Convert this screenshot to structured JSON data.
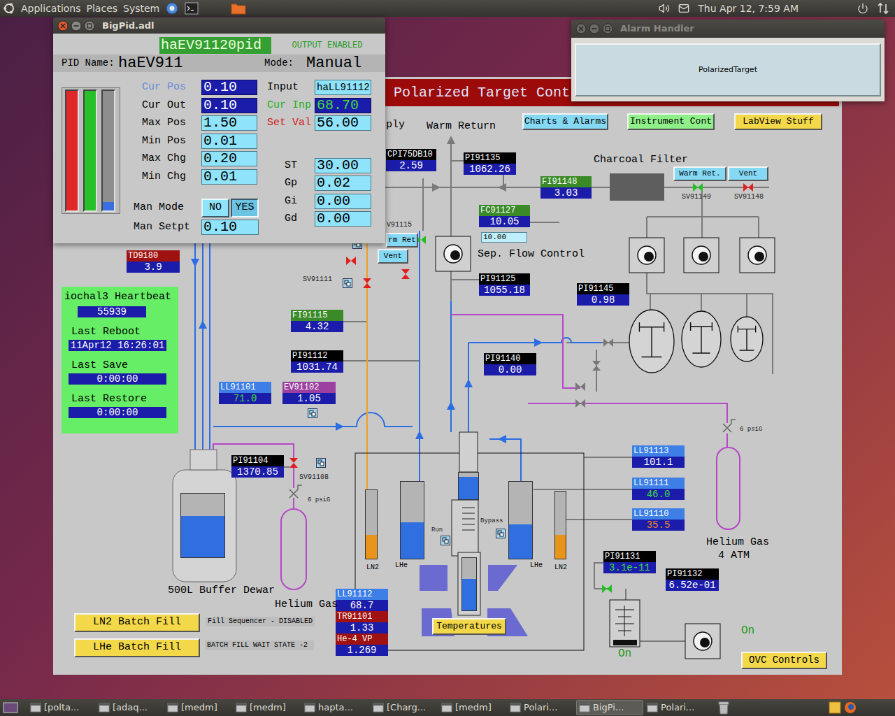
{
  "top_panel": {
    "menus": [
      "Applications",
      "Places",
      "System"
    ],
    "clock": "Thu Apr 12, 7:59 AM"
  },
  "taskbar": [
    {
      "label": "[polta...",
      "selected": false
    },
    {
      "label": "[adaq...",
      "selected": false
    },
    {
      "label": "[medm]",
      "selected": false
    },
    {
      "label": "[medm]",
      "selected": false
    },
    {
      "label": "hapta...",
      "selected": false
    },
    {
      "label": "[Charg...",
      "selected": false
    },
    {
      "label": "[medm]",
      "selected": false
    },
    {
      "label": "Polari...",
      "selected": false
    },
    {
      "label": "BigPi...",
      "selected": true
    },
    {
      "label": "Polari...",
      "selected": false
    }
  ],
  "bigpid_window": {
    "title": "BigPid.adl",
    "active": true,
    "pid_tag": "haEV91120pid",
    "output_status": "OUTPUT ENABLED",
    "pid_name_label": "PID Name:",
    "pid_name": "haEV911",
    "mode_label": "Mode:",
    "mode": "Manual",
    "meters": [
      {
        "level": 1,
        "color": "#e02828"
      },
      {
        "level": 1,
        "color": "#28c028"
      },
      {
        "level": 0.07,
        "color": "#3a6fe0"
      }
    ],
    "position_fields": [
      {
        "label": "Cur Pos",
        "value": "0.10",
        "kind": "readback",
        "label_color": "#6a8ad8",
        "value_color": "#ffffff"
      },
      {
        "label": "Cur Out",
        "value": "0.10",
        "kind": "readback",
        "label_color": "#000000",
        "value_color": "#ffffff"
      },
      {
        "label": "Max Pos",
        "value": "1.50",
        "kind": "entry",
        "label_color": "#000000"
      },
      {
        "label": "Min Pos",
        "value": "0.01",
        "kind": "entry",
        "label_color": "#000000"
      },
      {
        "label": "Max Chg",
        "value": "0.20",
        "kind": "entry",
        "label_color": "#000000"
      },
      {
        "label": "Min Chg",
        "value": "0.01",
        "kind": "entry",
        "label_color": "#000000"
      }
    ],
    "input_fields": [
      {
        "label": "Input",
        "value": "haLL91112",
        "kind": "entry",
        "label_color": "#000000"
      },
      {
        "label": "Cur Inp",
        "value": "68.70",
        "kind": "readback",
        "label_color": "#20b020",
        "value_color": "#3ddc3d"
      },
      {
        "label": "Set Val",
        "value": "56.00",
        "kind": "entry",
        "label_color": "#d02020"
      }
    ],
    "gain_fields": [
      {
        "label": "ST",
        "value": "30.00",
        "kind": "entry",
        "label_color": "#000000"
      },
      {
        "label": "Gp",
        "value": "0.02",
        "kind": "entry",
        "label_color": "#000000"
      },
      {
        "label": "Gi",
        "value": "0.00",
        "kind": "entry",
        "label_color": "#000000"
      },
      {
        "label": "Gd",
        "value": "0.00",
        "kind": "entry",
        "label_color": "#000000"
      }
    ],
    "man_mode": {
      "label": "Man Mode",
      "options": [
        {
          "label": "NO",
          "selected": false
        },
        {
          "label": "YES",
          "selected": true
        }
      ]
    },
    "man_setpt": {
      "label": "Man Setpt",
      "value": "0.10"
    }
  },
  "alarm_handler_window": {
    "title": "Alarm Handler",
    "active": false,
    "group": "PolarizedTarget"
  },
  "main_window": {
    "header": "Polarized Target Cont",
    "buttons": [
      {
        "label": "Charts & Alarms",
        "color": "#86d9f5"
      },
      {
        "label": "Instrument Cont",
        "color": "#8ff08a"
      },
      {
        "label": "LabView Stuff",
        "color": "#f3d84a"
      },
      {
        "label": "Warm Ret.",
        "color": "#86d9f5"
      },
      {
        "label": "Vent",
        "color": "#86d9f5"
      },
      {
        "label": "rm Ret",
        "color": "#86d9f5"
      },
      {
        "label": "Vent",
        "color": "#86d9f5"
      },
      {
        "label": "LN2 Batch Fill",
        "color": "#f3d84a"
      },
      {
        "label": "LHe Batch Fill",
        "color": "#f3d84a"
      },
      {
        "label": "Temperatures",
        "color": "#f3d84a"
      },
      {
        "label": "OVC Controls",
        "color": "#f3d84a"
      }
    ],
    "readouts": [
      {
        "tag": "CPI75DB10",
        "value": "2.59",
        "color": "#000000",
        "value_color": "#ffffff"
      },
      {
        "tag": "PI91135",
        "value": "1062.26",
        "color": "#000000",
        "value_color": "#ffffff"
      },
      {
        "tag": "FI91148",
        "value": "3.03",
        "color": "#3a8a28",
        "value_color": "#ffffff"
      },
      {
        "tag": "FC91127",
        "value": "10.05",
        "color": "#3a8a28",
        "value_color": "#ffffff"
      },
      {
        "tag": "PI91125",
        "value": "1055.18",
        "color": "#000000",
        "value_color": "#ffffff"
      },
      {
        "tag": "PI91145",
        "value": "0.98",
        "color": "#000000",
        "value_color": "#ffffff"
      },
      {
        "tag": "TD9180",
        "value": "3.9",
        "color": "#a01212",
        "value_color": "#ffffff"
      },
      {
        "tag": "FI91115",
        "value": "4.32",
        "color": "#3a8a28",
        "value_color": "#ffffff"
      },
      {
        "tag": "PI91112",
        "value": "1031.74",
        "color": "#000000",
        "value_color": "#ffffff"
      },
      {
        "tag": "PI91140",
        "value": "0.00",
        "color": "#000000",
        "value_color": "#ffffff"
      },
      {
        "tag": "LL91101",
        "value": "71.0",
        "color": "#3d7fe6",
        "value_color": "#3ddc3d"
      },
      {
        "tag": "EV91102",
        "value": "1.05",
        "color": "#9b3fa0",
        "value_color": "#ffffff"
      },
      {
        "tag": "PI91104",
        "value": "1370.85",
        "color": "#000000",
        "value_color": "#ffffff"
      },
      {
        "tag": "LL91113",
        "value": "101.1",
        "color": "#3d7fe6",
        "value_color": "#ffffff"
      },
      {
        "tag": "LL91111",
        "value": "46.0",
        "color": "#3d7fe6",
        "value_color": "#3ddc3d"
      },
      {
        "tag": "LL91110",
        "value": "35.5",
        "color": "#3d7fe6",
        "value_color": "#f08a20"
      },
      {
        "tag": "PI91131",
        "value": "3.1e-11",
        "color": "#000000",
        "value_color": "#3ddc3d"
      },
      {
        "tag": "PI91132",
        "value": "6.52e-01",
        "color": "#000000",
        "value_color": "#ffffff"
      },
      {
        "tag": "LL91112",
        "value": "68.7",
        "color": "#3d7fe6",
        "value_color": "#ffffff"
      },
      {
        "tag": "TR91101",
        "value": "1.33",
        "color": "#a01212",
        "value_color": "#ffffff"
      },
      {
        "tag": "He-4 VP",
        "value": "1.269",
        "color": "#a01212",
        "value_color": "#ffffff"
      }
    ],
    "labels": [
      {
        "text": "ply",
        "kind": "label"
      },
      {
        "text": "Warm Return",
        "kind": "label"
      },
      {
        "text": "Charcoal Filter",
        "kind": "label"
      },
      {
        "text": "Sep. Flow Control",
        "kind": "label"
      },
      {
        "text": "Helium Gas",
        "kind": "label"
      },
      {
        "text": "Helium Gas",
        "kind": "label"
      },
      {
        "text": "4 ATM",
        "kind": "label"
      },
      {
        "text": "Run",
        "kind": "small"
      },
      {
        "text": "Bypass",
        "kind": "small"
      },
      {
        "text": "6 psiG",
        "kind": "small"
      },
      {
        "text": "6 psiG",
        "kind": "small"
      },
      {
        "text": "On",
        "kind": "status",
        "color": "#1a9a1a"
      },
      {
        "text": "On",
        "kind": "status",
        "color": "#1a9a1a"
      }
    ],
    "valves": [
      {
        "label": "SV91149",
        "open": true
      },
      {
        "label": "SV91148",
        "open": false
      },
      {
        "label": "V91115",
        "open": true
      },
      {
        "open": false
      },
      {
        "label": "SV91111",
        "open": false
      },
      {
        "open": false
      },
      {
        "label": "SV91108",
        "open": false
      },
      {
        "open": true
      }
    ],
    "gauges": [
      {
        "label": "LN2",
        "kind": "gauge",
        "level": 0.35,
        "color": "#e8941a"
      },
      {
        "label": "LHe",
        "kind": "gauge",
        "level": 0.47,
        "color": "#2f6fe0"
      },
      {
        "kind": "gauge",
        "level": 0.85,
        "color": "#2f6fe0"
      },
      {
        "label": "LHe",
        "kind": "gauge",
        "level": 0.45,
        "color": "#2f6fe0"
      },
      {
        "label": "LN2",
        "kind": "gauge",
        "level": 0.35,
        "color": "#e8941a"
      },
      {
        "label": "500L Buffer Dewar",
        "kind": "tank",
        "level": 0.65,
        "color": "#2f6fe0"
      },
      {
        "kind": "gauge",
        "level": 0.6,
        "color": "#2f6fe0"
      }
    ],
    "flow_setpoint": "10.00",
    "heartbeat": {
      "title": "iochal3 Heartbeat",
      "count": "55939",
      "rows": [
        {
          "label": "Last Reboot",
          "value": "11Apr12 16:26:01"
        },
        {
          "label": "Last Save",
          "value": "0:00:00"
        },
        {
          "label": "Last Restore",
          "value": "0:00:00"
        }
      ]
    },
    "status_boxes": [
      "Fill Sequencer - DISABLED",
      "BATCH FILL WAIT STATE -2"
    ]
  }
}
